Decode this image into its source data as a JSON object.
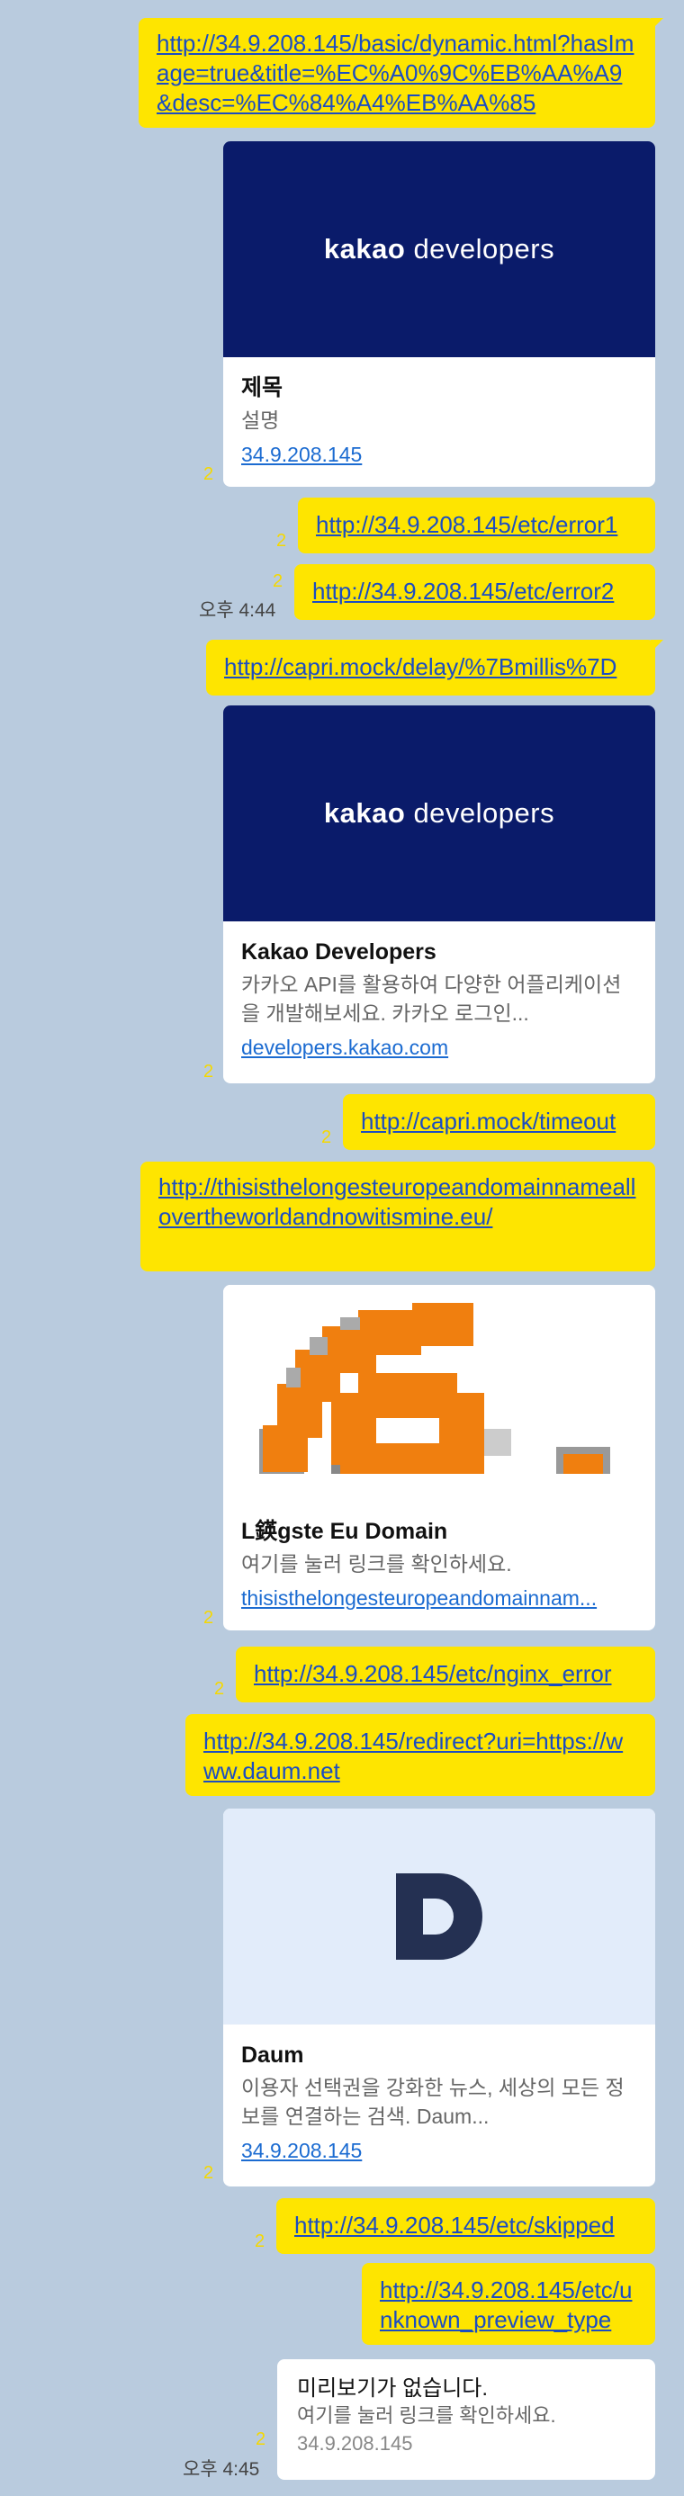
{
  "messages": {
    "m1": {
      "link": "http://34.9.208.145/basic/dynamic.html?hasImage=true&title=%EC%A0%9C%EB%AA%A9&desc=%EC%84%A4%EB%AA%85"
    },
    "card1": {
      "logo_word1": "kakao",
      "logo_word2": "developers",
      "title": "제목",
      "desc": "설명",
      "domain": "34.9.208.145",
      "unread": "2"
    },
    "m2": {
      "link": "http://34.9.208.145/etc/error1",
      "unread": "2"
    },
    "m3": {
      "link": "http://34.9.208.145/etc/error2",
      "unread": "2",
      "time": "오후 4:44"
    },
    "m4": {
      "link": "http://capri.mock/delay/%7Bmillis%7D"
    },
    "card2": {
      "logo_word1": "kakao",
      "logo_word2": "developers",
      "title": "Kakao Developers",
      "desc": "카카오 API를 활용하여 다양한 어플리케이션을 개발해보세요. 카카오 로그인...",
      "domain": "developers.kakao.com",
      "unread": "2"
    },
    "m5": {
      "link": "http://capri.mock/timeout",
      "unread": "2"
    },
    "m6": {
      "link": "http://thisisthelongesteuropeandomainnameallovertheworldandnowitismine.eu/"
    },
    "card3": {
      "title": "L鍈gste Eu Domain",
      "desc": "여기를 눌러 링크를 확인하세요.",
      "domain": "thisisthelongesteuropeandomainnam...",
      "unread": "2"
    },
    "m7": {
      "link": "http://34.9.208.145/etc/nginx_error",
      "unread": "2"
    },
    "m8": {
      "link": "http://34.9.208.145/redirect?uri=https://www.daum.net"
    },
    "card4": {
      "logo_letter": "D",
      "title": "Daum",
      "desc": "이용자 선택권을 강화한 뉴스, 세상의 모든 정보를 연결하는 검색. Daum...",
      "domain": "34.9.208.145",
      "unread": "2"
    },
    "m9": {
      "link": "http://34.9.208.145/etc/skipped",
      "unread": "2"
    },
    "m10": {
      "link": "http://34.9.208.145/etc/unknown_preview_type"
    },
    "nopreview": {
      "title": "미리보기가 없습니다.",
      "desc": "여기를 눌러 링크를 확인하세요.",
      "domain": "34.9.208.145",
      "unread": "2",
      "time": "오후 4:45"
    }
  },
  "colors": {
    "background": "#b9cbde",
    "bubble": "#fee500",
    "link": "#1b4dc2",
    "kakao_navy": "#0a1b6a",
    "eu_orange": "#f07f0f",
    "daum_bg": "#e2ecfa",
    "daum_navy": "#243052"
  }
}
